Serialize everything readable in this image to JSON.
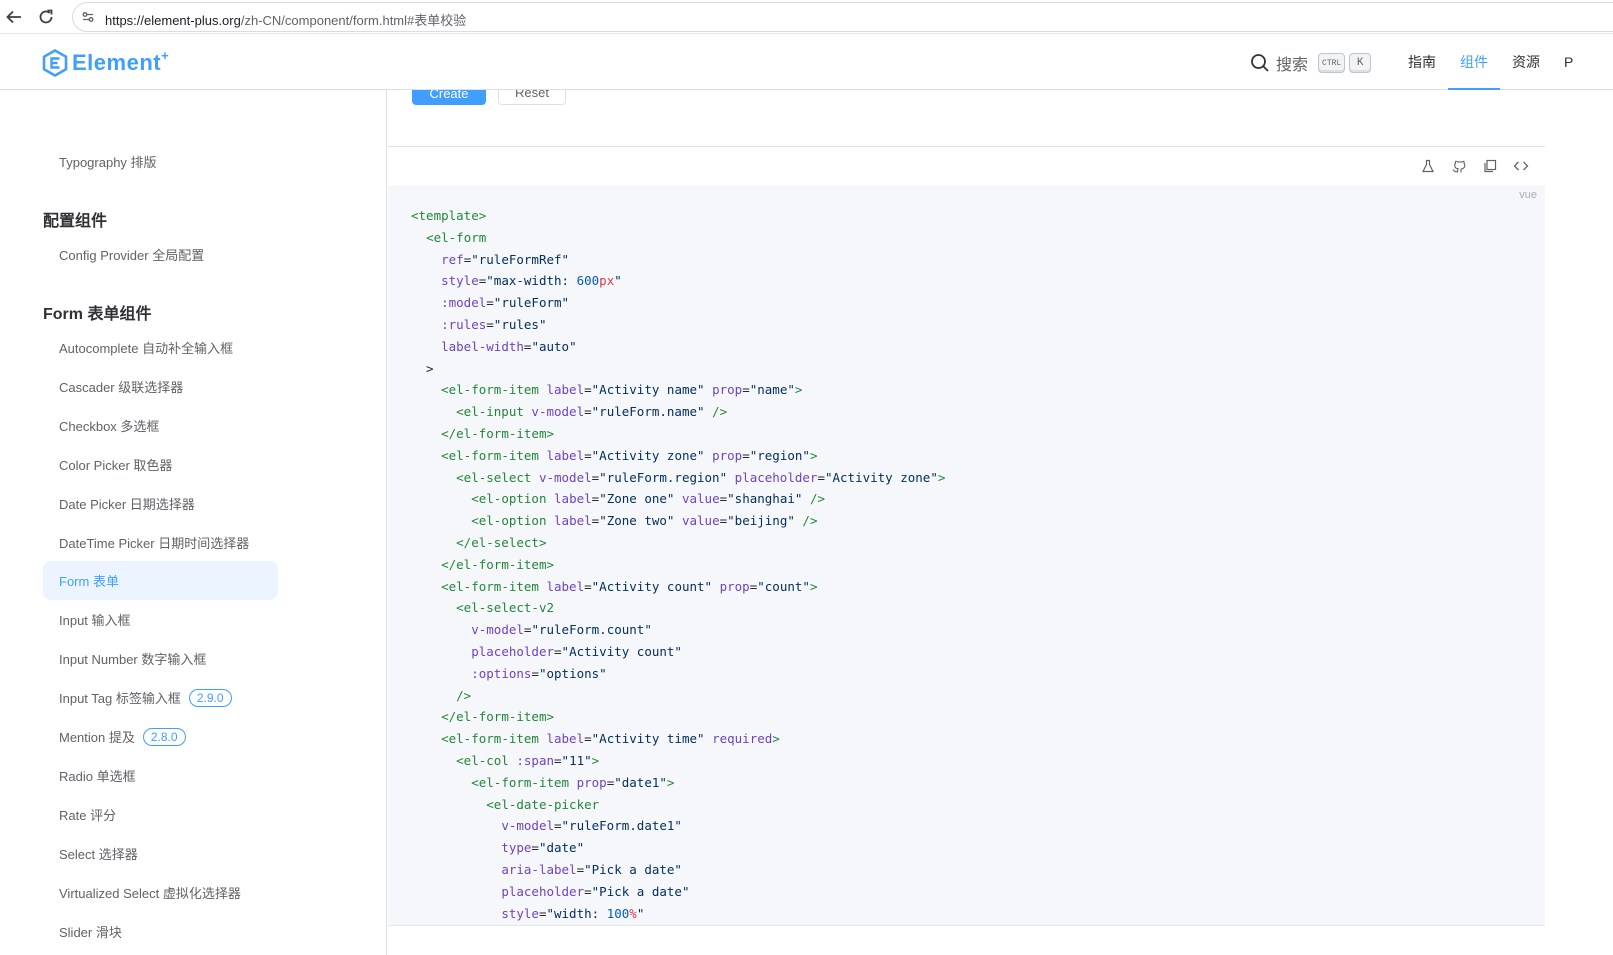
{
  "browser": {
    "url_host": "https://element-plus.org",
    "url_rest": "/zh-CN/component/form.html#表单校验"
  },
  "header": {
    "logo_text": "Element",
    "logo_sup": "+",
    "search_label": "搜索",
    "search_key1": "CTRL",
    "search_key2": "K",
    "nav": [
      "指南",
      "组件",
      "资源",
      "P"
    ],
    "active_nav": "组件",
    "accent": "#409eff"
  },
  "sidebar": {
    "top_item": "Typography 排版",
    "groups": [
      "配置组件",
      "Form 表单组件"
    ],
    "config_item": "Config Provider 全局配置",
    "items": [
      {
        "label": "Autocomplete 自动补全输入框"
      },
      {
        "label": "Cascader 级联选择器"
      },
      {
        "label": "Checkbox 多选框"
      },
      {
        "label": "Color Picker 取色器"
      },
      {
        "label": "Date Picker 日期选择器"
      },
      {
        "label": "DateTime Picker 日期时间选择器"
      },
      {
        "label": "Form 表单",
        "active": true
      },
      {
        "label": "Input 输入框"
      },
      {
        "label": "Input Number 数字输入框"
      },
      {
        "label": "Input Tag 标签输入框",
        "badge": "2.9.0"
      },
      {
        "label": "Mention 提及",
        "badge": "2.8.0"
      },
      {
        "label": "Radio 单选框"
      },
      {
        "label": "Rate 评分"
      },
      {
        "label": "Select 选择器"
      },
      {
        "label": "Virtualized Select 虚拟化选择器"
      },
      {
        "label": "Slider 滑块"
      }
    ]
  },
  "demo": {
    "create_label": "Create",
    "reset_label": "Reset",
    "lang_tag": "vue"
  },
  "code_lines": [
    [
      [
        "tg",
        "<template>"
      ]
    ],
    [
      [
        "tx",
        "  "
      ],
      [
        "tg",
        "<el-form"
      ]
    ],
    [
      [
        "tx",
        "    "
      ],
      [
        "at",
        "ref"
      ],
      [
        "tx",
        "="
      ],
      [
        "st",
        "\"ruleFormRef\""
      ]
    ],
    [
      [
        "tx",
        "    "
      ],
      [
        "at",
        "style"
      ],
      [
        "tx",
        "="
      ],
      [
        "st",
        "\"max-width: "
      ],
      [
        "nm",
        "600"
      ],
      [
        "un",
        "px"
      ],
      [
        "st",
        "\""
      ]
    ],
    [
      [
        "tx",
        "    "
      ],
      [
        "at",
        ":model"
      ],
      [
        "tx",
        "="
      ],
      [
        "st",
        "\"ruleForm\""
      ]
    ],
    [
      [
        "tx",
        "    "
      ],
      [
        "at",
        ":rules"
      ],
      [
        "tx",
        "="
      ],
      [
        "st",
        "\"rules\""
      ]
    ],
    [
      [
        "tx",
        "    "
      ],
      [
        "at",
        "label-width"
      ],
      [
        "tx",
        "="
      ],
      [
        "st",
        "\"auto\""
      ]
    ],
    [
      [
        "tx",
        "  >"
      ]
    ],
    [
      [
        "tx",
        "    "
      ],
      [
        "tg",
        "<el-form-item"
      ],
      [
        "tx",
        " "
      ],
      [
        "at",
        "label"
      ],
      [
        "tx",
        "="
      ],
      [
        "st",
        "\"Activity name\""
      ],
      [
        "tx",
        " "
      ],
      [
        "at",
        "prop"
      ],
      [
        "tx",
        "="
      ],
      [
        "st",
        "\"name\""
      ],
      [
        "tg",
        ">"
      ]
    ],
    [
      [
        "tx",
        "      "
      ],
      [
        "tg",
        "<el-input"
      ],
      [
        "tx",
        " "
      ],
      [
        "at",
        "v-model"
      ],
      [
        "tx",
        "="
      ],
      [
        "st",
        "\"ruleForm.name\""
      ],
      [
        "tx",
        " "
      ],
      [
        "tg",
        "/>"
      ]
    ],
    [
      [
        "tx",
        "    "
      ],
      [
        "tg",
        "</el-form-item>"
      ]
    ],
    [
      [
        "tx",
        "    "
      ],
      [
        "tg",
        "<el-form-item"
      ],
      [
        "tx",
        " "
      ],
      [
        "at",
        "label"
      ],
      [
        "tx",
        "="
      ],
      [
        "st",
        "\"Activity zone\""
      ],
      [
        "tx",
        " "
      ],
      [
        "at",
        "prop"
      ],
      [
        "tx",
        "="
      ],
      [
        "st",
        "\"region\""
      ],
      [
        "tg",
        ">"
      ]
    ],
    [
      [
        "tx",
        "      "
      ],
      [
        "tg",
        "<el-select"
      ],
      [
        "tx",
        " "
      ],
      [
        "at",
        "v-model"
      ],
      [
        "tx",
        "="
      ],
      [
        "st",
        "\"ruleForm.region\""
      ],
      [
        "tx",
        " "
      ],
      [
        "at",
        "placeholder"
      ],
      [
        "tx",
        "="
      ],
      [
        "st",
        "\"Activity zone\""
      ],
      [
        "tg",
        ">"
      ]
    ],
    [
      [
        "tx",
        "        "
      ],
      [
        "tg",
        "<el-option"
      ],
      [
        "tx",
        " "
      ],
      [
        "at",
        "label"
      ],
      [
        "tx",
        "="
      ],
      [
        "st",
        "\"Zone one\""
      ],
      [
        "tx",
        " "
      ],
      [
        "at",
        "value"
      ],
      [
        "tx",
        "="
      ],
      [
        "st",
        "\"shanghai\""
      ],
      [
        "tx",
        " "
      ],
      [
        "tg",
        "/>"
      ]
    ],
    [
      [
        "tx",
        "        "
      ],
      [
        "tg",
        "<el-option"
      ],
      [
        "tx",
        " "
      ],
      [
        "at",
        "label"
      ],
      [
        "tx",
        "="
      ],
      [
        "st",
        "\"Zone two\""
      ],
      [
        "tx",
        " "
      ],
      [
        "at",
        "value"
      ],
      [
        "tx",
        "="
      ],
      [
        "st",
        "\"beijing\""
      ],
      [
        "tx",
        " "
      ],
      [
        "tg",
        "/>"
      ]
    ],
    [
      [
        "tx",
        "      "
      ],
      [
        "tg",
        "</el-select>"
      ]
    ],
    [
      [
        "tx",
        "    "
      ],
      [
        "tg",
        "</el-form-item>"
      ]
    ],
    [
      [
        "tx",
        "    "
      ],
      [
        "tg",
        "<el-form-item"
      ],
      [
        "tx",
        " "
      ],
      [
        "at",
        "label"
      ],
      [
        "tx",
        "="
      ],
      [
        "st",
        "\"Activity count\""
      ],
      [
        "tx",
        " "
      ],
      [
        "at",
        "prop"
      ],
      [
        "tx",
        "="
      ],
      [
        "st",
        "\"count\""
      ],
      [
        "tg",
        ">"
      ]
    ],
    [
      [
        "tx",
        "      "
      ],
      [
        "tg",
        "<el-select-v2"
      ]
    ],
    [
      [
        "tx",
        "        "
      ],
      [
        "at",
        "v-model"
      ],
      [
        "tx",
        "="
      ],
      [
        "st",
        "\"ruleForm.count\""
      ]
    ],
    [
      [
        "tx",
        "        "
      ],
      [
        "at",
        "placeholder"
      ],
      [
        "tx",
        "="
      ],
      [
        "st",
        "\"Activity count\""
      ]
    ],
    [
      [
        "tx",
        "        "
      ],
      [
        "at",
        ":options"
      ],
      [
        "tx",
        "="
      ],
      [
        "st",
        "\"options\""
      ]
    ],
    [
      [
        "tx",
        "      "
      ],
      [
        "tg",
        "/>"
      ]
    ],
    [
      [
        "tx",
        "    "
      ],
      [
        "tg",
        "</el-form-item>"
      ]
    ],
    [
      [
        "tx",
        "    "
      ],
      [
        "tg",
        "<el-form-item"
      ],
      [
        "tx",
        " "
      ],
      [
        "at",
        "label"
      ],
      [
        "tx",
        "="
      ],
      [
        "st",
        "\"Activity time\""
      ],
      [
        "tx",
        " "
      ],
      [
        "at",
        "required"
      ],
      [
        "tg",
        ">"
      ]
    ],
    [
      [
        "tx",
        "      "
      ],
      [
        "tg",
        "<el-col"
      ],
      [
        "tx",
        " "
      ],
      [
        "at",
        ":span"
      ],
      [
        "tx",
        "="
      ],
      [
        "st",
        "\"11\""
      ],
      [
        "tg",
        ">"
      ]
    ],
    [
      [
        "tx",
        "        "
      ],
      [
        "tg",
        "<el-form-item"
      ],
      [
        "tx",
        " "
      ],
      [
        "at",
        "prop"
      ],
      [
        "tx",
        "="
      ],
      [
        "st",
        "\"date1\""
      ],
      [
        "tg",
        ">"
      ]
    ],
    [
      [
        "tx",
        "          "
      ],
      [
        "tg",
        "<el-date-picker"
      ]
    ],
    [
      [
        "tx",
        "            "
      ],
      [
        "at",
        "v-model"
      ],
      [
        "tx",
        "="
      ],
      [
        "st",
        "\"ruleForm.date1\""
      ]
    ],
    [
      [
        "tx",
        "            "
      ],
      [
        "at",
        "type"
      ],
      [
        "tx",
        "="
      ],
      [
        "st",
        "\"date\""
      ]
    ],
    [
      [
        "tx",
        "            "
      ],
      [
        "at",
        "aria-label"
      ],
      [
        "tx",
        "="
      ],
      [
        "st",
        "\"Pick a date\""
      ]
    ],
    [
      [
        "tx",
        "            "
      ],
      [
        "at",
        "placeholder"
      ],
      [
        "tx",
        "="
      ],
      [
        "st",
        "\"Pick a date\""
      ]
    ],
    [
      [
        "tx",
        "            "
      ],
      [
        "at",
        "style"
      ],
      [
        "tx",
        "="
      ],
      [
        "st",
        "\"width: "
      ],
      [
        "nm",
        "100"
      ],
      [
        "un",
        "%"
      ],
      [
        "st",
        "\""
      ]
    ]
  ]
}
